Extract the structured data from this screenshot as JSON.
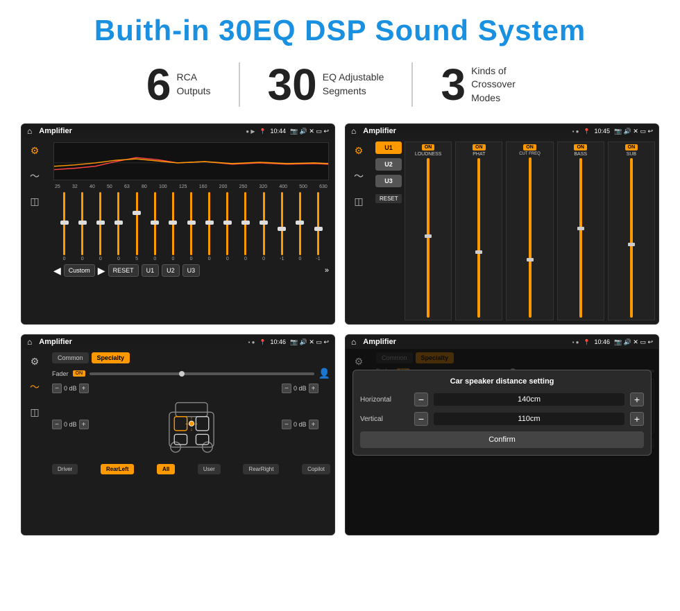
{
  "title": "Buith-in 30EQ DSP Sound System",
  "stats": [
    {
      "number": "6",
      "line1": "RCA",
      "line2": "Outputs"
    },
    {
      "number": "30",
      "line1": "EQ Adjustable",
      "line2": "Segments"
    },
    {
      "number": "3",
      "line1": "Kinds of",
      "line2": "Crossover Modes"
    }
  ],
  "screens": [
    {
      "title": "Amplifier",
      "time": "10:44",
      "type": "eq"
    },
    {
      "title": "Amplifier",
      "time": "10:45",
      "type": "crossover"
    },
    {
      "title": "Amplifier",
      "time": "10:46",
      "type": "speaker"
    },
    {
      "title": "Amplifier",
      "time": "10:46",
      "type": "distance"
    }
  ],
  "eq": {
    "freqs": [
      "25",
      "32",
      "40",
      "50",
      "63",
      "80",
      "100",
      "125",
      "160",
      "200",
      "250",
      "320",
      "400",
      "500",
      "630"
    ],
    "values": [
      "0",
      "0",
      "0",
      "0",
      "5",
      "0",
      "0",
      "0",
      "0",
      "0",
      "0",
      "0",
      "-1",
      "0",
      "-1"
    ],
    "buttons": [
      "Custom",
      "RESET",
      "U1",
      "U2",
      "U3"
    ]
  },
  "crossover": {
    "channels": [
      "U1",
      "U2",
      "U3"
    ],
    "controls": [
      "LOUDNESS",
      "PHAT",
      "CUT FREQ",
      "BASS",
      "SUB"
    ],
    "reset": "RESET"
  },
  "speaker": {
    "tabs": [
      "Common",
      "Specialty"
    ],
    "fader_label": "Fader",
    "fader_on": "ON",
    "left_values": [
      "0 dB",
      "0 dB"
    ],
    "right_values": [
      "0 dB",
      "0 dB"
    ],
    "buttons": [
      "Driver",
      "RearLeft",
      "All",
      "User",
      "RearRight",
      "Copilot"
    ]
  },
  "distance": {
    "dialog_title": "Car speaker distance setting",
    "horizontal_label": "Horizontal",
    "horizontal_value": "140cm",
    "vertical_label": "Vertical",
    "vertical_value": "110cm",
    "confirm_label": "Confirm"
  }
}
